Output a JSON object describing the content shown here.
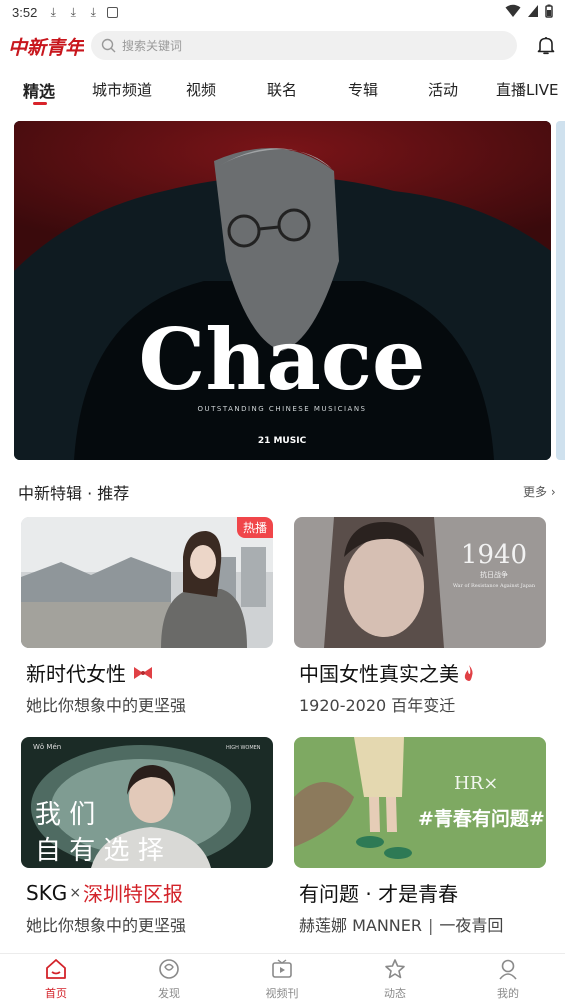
{
  "status_bar": {
    "time": "3:52"
  },
  "header": {
    "logo_text": "中新青年",
    "search_placeholder": "搜索关键词"
  },
  "tabs": [
    {
      "label": "精选",
      "active": true
    },
    {
      "label": "城市频道"
    },
    {
      "label": "视频"
    },
    {
      "label": "联名"
    },
    {
      "label": "专辑"
    },
    {
      "label": "活动"
    },
    {
      "label": "直播LIVE"
    }
  ],
  "banner": {
    "headline": "Chace",
    "tagline": "OUTSTANDING CHINESE MUSICIANS",
    "brand": "21 MUSIC"
  },
  "section": {
    "title": "中新特辑 · 推荐",
    "more": "更多"
  },
  "cards": [
    {
      "title": "新时代女性",
      "subtitle": "她比你想象中的更坚强",
      "badge": "热播"
    },
    {
      "title": "中国女性真实之美",
      "subtitle": "1920-2020 百年变迁",
      "overlay_year": "1940",
      "overlay_caption_1": "抗日战争",
      "overlay_caption_2": "War of Resistance Against Japan"
    },
    {
      "title_prefix": "SKG",
      "title_times": "×",
      "title_accent": "深圳特区报",
      "subtitle": "她比你想象中的更坚强",
      "overlay_big": "我 们",
      "overlay_big_2": "自 有 选 择",
      "overlay_small_left": "Wǒ Mén",
      "overlay_small_right": "HIGH WOMEN"
    },
    {
      "title": "有问题 · 才是青春",
      "subtitle_a": "赫莲娜 MANNER",
      "subtitle_sep": "|",
      "subtitle_b": "一夜青回",
      "overlay_tag": "#青春有问题#",
      "overlay_logo": "HR×"
    }
  ],
  "bottom_nav": [
    {
      "label": "首页",
      "active": true
    },
    {
      "label": "发现"
    },
    {
      "label": "视频刊"
    },
    {
      "label": "动态"
    },
    {
      "label": "我的"
    }
  ],
  "colors": {
    "accent": "#d3232a",
    "badge": "#f0464a"
  }
}
